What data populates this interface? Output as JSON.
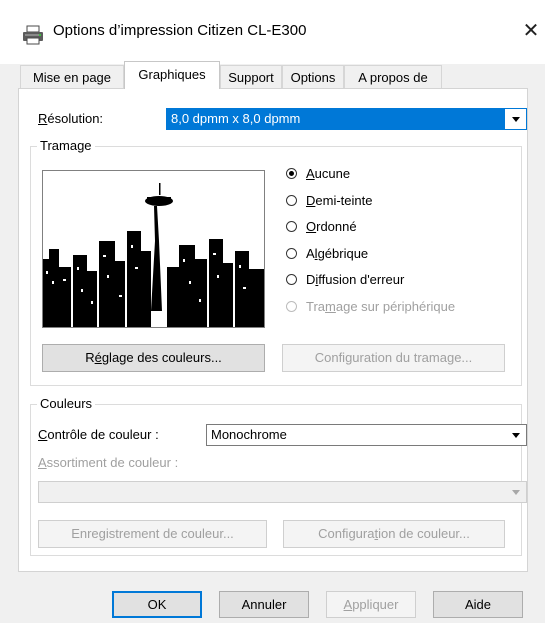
{
  "window": {
    "title": "Options d’impression Citizen CL-E300",
    "close_glyph": "✕"
  },
  "tabs": [
    {
      "label": "Mise en page",
      "active": false
    },
    {
      "label": "Graphiques",
      "active": true
    },
    {
      "label": "Support",
      "active": false
    },
    {
      "label": "Options",
      "active": false
    },
    {
      "label": "A propos de",
      "active": false
    }
  ],
  "resolution": {
    "label_pre": "",
    "label_access": "R",
    "label_post": "ésolution:",
    "value": "8,0 dpmm x 8,0 dpmm"
  },
  "tramage": {
    "title": "Tramage",
    "options": [
      {
        "pre": "",
        "access": "A",
        "post": "ucune",
        "checked": true,
        "enabled": true
      },
      {
        "pre": "",
        "access": "D",
        "post": "emi-teinte",
        "checked": false,
        "enabled": true
      },
      {
        "pre": "",
        "access": "O",
        "post": "rdonné",
        "checked": false,
        "enabled": true
      },
      {
        "pre": "A",
        "access": "l",
        "post": "gébrique",
        "checked": false,
        "enabled": true
      },
      {
        "pre": "D",
        "access": "i",
        "post": "ffusion d'erreur",
        "checked": false,
        "enabled": true
      },
      {
        "pre": "Tra",
        "access": "m",
        "post": "age sur périphérique",
        "checked": false,
        "enabled": false
      }
    ],
    "color_adjust_button": {
      "pre": "R",
      "access": "é",
      "post": "glage des couleurs..."
    },
    "config_button": "Configuration du tramage..."
  },
  "couleurs": {
    "title": "Couleurs",
    "control_label": {
      "pre": "",
      "access": "C",
      "post": "ontrôle de couleur :"
    },
    "control_value": "Monochrome",
    "matching_label": {
      "pre": "",
      "access": "A",
      "post": "ssortiment de couleur :"
    },
    "matching_value": "",
    "save_button": {
      "pre": "Enre",
      "access": "g",
      "post": "istrement de couleur..."
    },
    "config_button": {
      "pre": "Configura",
      "access": "t",
      "post": "ion de couleur..."
    }
  },
  "footer": {
    "ok": "OK",
    "cancel": "Annuler",
    "apply": {
      "pre": "",
      "access": "A",
      "post": "ppliquer"
    },
    "help": "Aide"
  }
}
